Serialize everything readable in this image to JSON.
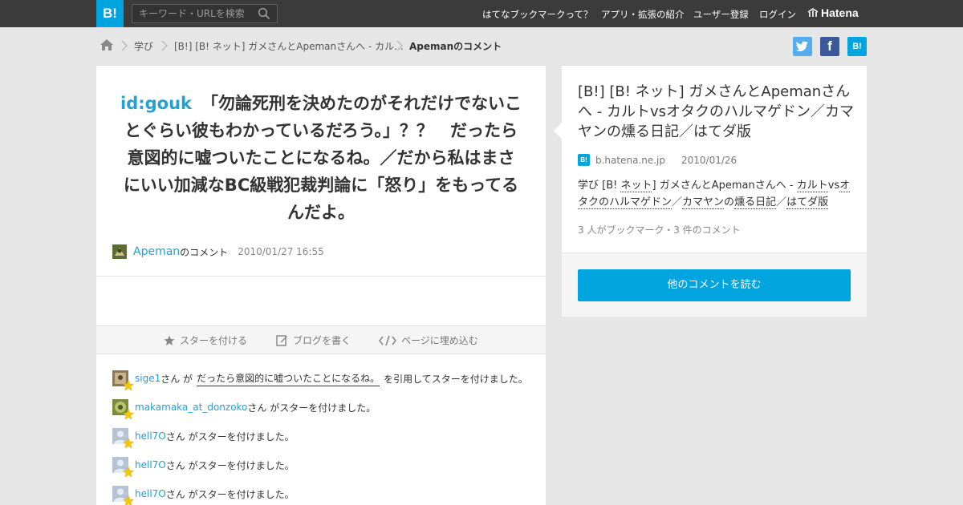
{
  "header": {
    "logo": "B!",
    "search_placeholder": "キーワード・URLを検索",
    "nav": [
      "はてなブックマークって？",
      "アプリ・拡張の紹介",
      "ユーザー登録",
      "ログイン"
    ],
    "brand": "Hatena"
  },
  "breadcrumb": {
    "items": [
      "学び",
      "[B!] [B! ネット] ガメさんとApemanさんへ - カル...",
      "Apemanのコメント"
    ]
  },
  "share": {
    "twitter": "t",
    "facebook": "f",
    "hatena": "B!"
  },
  "comment": {
    "user_id": "id:gouk",
    "text": "「勿論死刑を決めたのがそれだけでないことぐらい彼もわかっているだろう。」？？　だったら意図的に嘘ついたことになるね。／だから私はまさにいい加減なBC級戦犯裁判論に「怒り」をもってるんだよ。",
    "author": "Apeman",
    "author_suffix": "のコメント",
    "timestamp": "2010/01/27 16:55"
  },
  "actions": {
    "star": "スターを付ける",
    "blog": "ブログを書く",
    "embed": "ページに埋め込む"
  },
  "stars": [
    {
      "user": "sige1",
      "pre": "さん が",
      "quote": "だったら意図的に嘘ついたことになるね。",
      "post": "を引用してスターを付けました。"
    },
    {
      "user": "makamaka_at_donzoko",
      "text": "さん がスターを付けました。"
    },
    {
      "user": "hell7O",
      "text": "さん がスターを付けました。"
    },
    {
      "user": "hell7O",
      "text": "さん がスターを付けました。"
    },
    {
      "user": "hell7O",
      "text": "さん がスターを付けました。"
    }
  ],
  "side": {
    "title": "[B!] [B! ネット] ガメさんとApemanさんへ - カルトvsオタクのハルマゲドン／カマヤンの燻る日記／はてダ版",
    "domain": "b.hatena.ne.jp",
    "date": "2010/01/26",
    "desc_prefix": "学び [B! ",
    "desc_tag1": "ネット",
    "desc_mid1": "] ガメさんとApemanさんへ - ",
    "desc_tag2": "カルト",
    "desc_mid2": "vs",
    "desc_tag3": "オタクのハルマゲドン",
    "desc_mid3": "／",
    "desc_tag4": "カマヤン",
    "desc_mid4": "の",
    "desc_tag5": "燻る日記",
    "desc_mid5": "／",
    "desc_tag6": "はてダ版",
    "count": "3 人がブックマーク・3 件のコメント",
    "read_more": "他のコメントを読む"
  },
  "colors": {
    "accent": "#00a4de",
    "link": "#25a0d3",
    "twitter": "#55acee",
    "facebook": "#3b5998"
  }
}
